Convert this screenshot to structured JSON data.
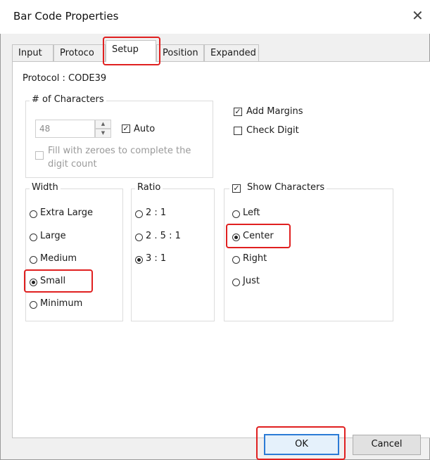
{
  "window": {
    "title": "Bar Code Properties",
    "close_glyph": "✕"
  },
  "tabs": [
    {
      "label": "Input",
      "active": false
    },
    {
      "label": "Protoco",
      "active": false
    },
    {
      "label": "Setup",
      "active": true
    },
    {
      "label": "Position",
      "active": false
    },
    {
      "label": "Expanded",
      "active": false
    }
  ],
  "setup": {
    "protocol_text": "Protocol : CODE39",
    "characters_group": {
      "title": "# of Characters",
      "count_value": "48",
      "auto_label": "Auto",
      "auto_checked": true,
      "fill_zeroes_line1": "Fill with zeroes to complete the",
      "fill_zeroes_line2": "digit count",
      "fill_zeroes_checked": false
    },
    "add_margins": {
      "label": "Add Margins",
      "checked": true
    },
    "check_digit": {
      "label": "Check Digit",
      "checked": false
    },
    "width_group": {
      "title": "Width",
      "options": [
        "Extra Large",
        "Large",
        "Medium",
        "Small",
        "Minimum"
      ],
      "selected": "Small"
    },
    "ratio_group": {
      "title": "Ratio",
      "options": [
        "2 : 1",
        "2 . 5 : 1",
        "3 : 1"
      ],
      "selected": "3 : 1"
    },
    "show_characters_group": {
      "title": "Show Characters",
      "checked": true,
      "options": [
        "Left",
        "Center",
        "Right",
        "Just"
      ],
      "selected": "Center"
    }
  },
  "buttons": {
    "ok": "OK",
    "cancel": "Cancel"
  },
  "colors": {
    "highlight": "#e02020",
    "default_button_border": "#2b7bd6",
    "dialog_bg": "#f0f0f0"
  }
}
